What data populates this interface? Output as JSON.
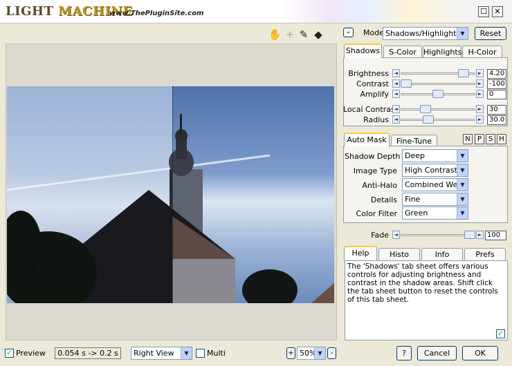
{
  "title": {
    "logo_part1": "LIGHT",
    "logo_part2": "MACHINE",
    "site": "www.ThePluginSite.com"
  },
  "window_buttons": {
    "restore": "☐",
    "close": "✕"
  },
  "tools": {
    "hand": "✋",
    "crosshair": "+",
    "eyedropper": "✎",
    "split": "◆"
  },
  "mode": {
    "label": "Mode",
    "value": "Shadows/Highlights Pro",
    "reset": "Reset",
    "menu_icon": "⌄"
  },
  "top_tabs": [
    "Shadows",
    "S-Color",
    "Highlights",
    "H-Color"
  ],
  "sliders": [
    {
      "label": "Brightness",
      "value": "4.20",
      "fraction": 0.9
    },
    {
      "label": "Contrast",
      "value": "-100",
      "fraction": 0.0
    },
    {
      "label": "Amplify",
      "value": "0",
      "fraction": 0.5
    },
    {
      "label": "Local Contrast",
      "value": "30",
      "fraction": 0.3
    },
    {
      "label": "Radius",
      "value": "30.0",
      "fraction": 0.35
    }
  ],
  "mask_tabs": [
    "Auto Mask",
    "Fine-Tune"
  ],
  "mask_buttons": [
    "N",
    "P",
    "S",
    "H"
  ],
  "mask_fields": [
    {
      "label": "Shadow Depth",
      "value": "Deep"
    },
    {
      "label": "Image Type",
      "value": "High Contrast"
    },
    {
      "label": "Anti-Halo",
      "value": "Combined Weak"
    },
    {
      "label": "Details",
      "value": "Fine"
    },
    {
      "label": "Color Filter",
      "value": "Green"
    }
  ],
  "fade": {
    "label": "Fade",
    "value": "100",
    "fraction": 1.0
  },
  "bottom_tabs": [
    "Help",
    "Histo",
    "Info",
    "Prefs"
  ],
  "help_text": "The 'Shadows' tab sheet offers various controls for adjusting brightness and contrast in the shadow areas. Shift click the tab sheet button to reset the controls of this tab sheet.",
  "footer": {
    "preview_label": "Preview",
    "timing": "0.054 s -> 0.2 s",
    "view": "Right View",
    "multi_label": "Multi",
    "zoom": "50%",
    "zoom_in": "+",
    "zoom_out": "-",
    "help": "?",
    "cancel": "Cancel",
    "ok": "OK"
  },
  "checkmark": "✓"
}
